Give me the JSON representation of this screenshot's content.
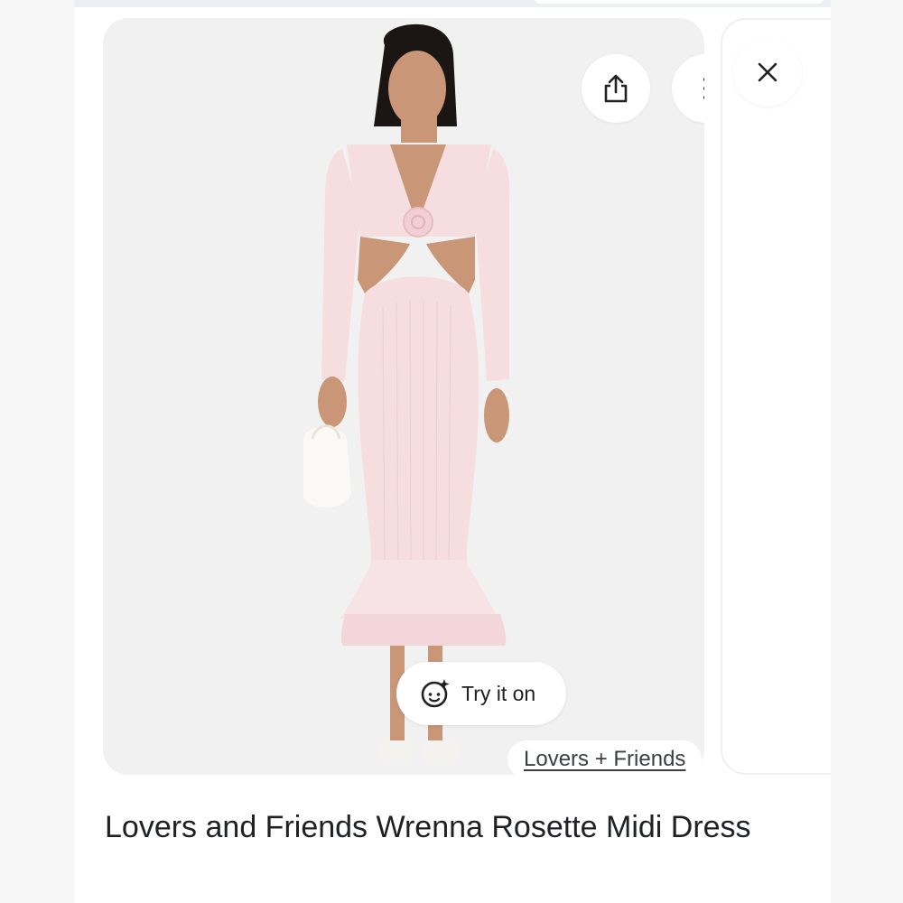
{
  "viewer": {
    "actions": {
      "share_icon": "share-icon",
      "more_icon": "more-vert-icon",
      "close_icon": "close-icon"
    },
    "try_on": {
      "icon": "face-sparkle-icon",
      "label": "Try it on"
    },
    "source": {
      "label": "Lovers + Friends"
    },
    "product_title": "Lovers and Friends Wrenna Rosette Midi Dress"
  },
  "colors": {
    "dress": "#f6dde0",
    "skin": "#c99677",
    "hair": "#1b1513",
    "card_bg": "#f1f1f1"
  }
}
